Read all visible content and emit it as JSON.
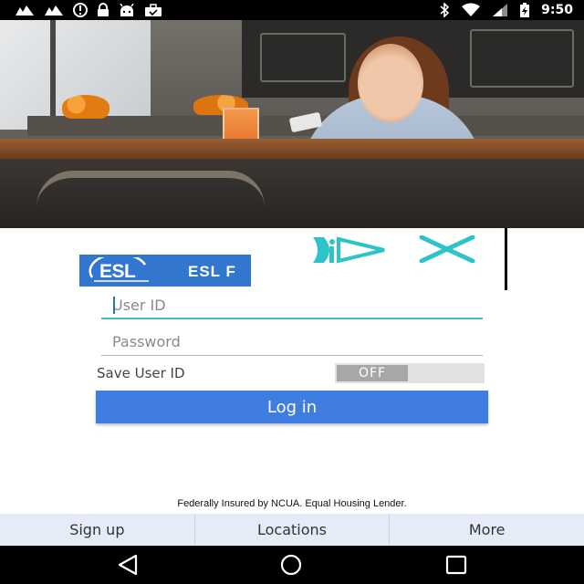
{
  "status_bar": {
    "time": "9:50",
    "left_icons": [
      "signal-icon",
      "signal-icon",
      "alert-icon",
      "lock-icon",
      "android-icon",
      "briefcase-icon"
    ],
    "right_icons": [
      "bluetooth-icon",
      "wifi-icon",
      "cell-signal-icon",
      "battery-charging-icon"
    ]
  },
  "brand": {
    "logo_text": "ESL",
    "title": "ESL F",
    "color": "#3276d0"
  },
  "ad": {
    "play_icon": "ad-play-icon",
    "close_icon": "ad-close-icon",
    "accent": "#2cc3c9"
  },
  "form": {
    "user_id_placeholder": "User ID",
    "password_placeholder": "Password",
    "save_user_label": "Save User ID",
    "save_user_state": "OFF",
    "login_label": "Log in"
  },
  "footer": {
    "note": "Federally Insured by NCUA. Equal Housing Lender."
  },
  "tabs": [
    {
      "label": "Sign up"
    },
    {
      "label": "Locations"
    },
    {
      "label": "More"
    }
  ],
  "nav": [
    "back-icon",
    "home-icon",
    "recents-icon"
  ],
  "colors": {
    "primary_button": "#3f7de0",
    "tab_bar": "#e5ecf8",
    "focus_underline": "#4cb8c8"
  }
}
